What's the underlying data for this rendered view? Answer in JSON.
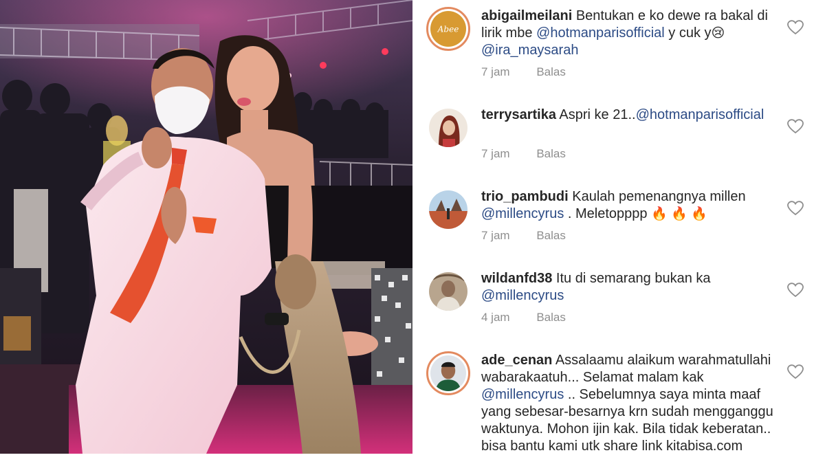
{
  "comments": [
    {
      "username": "abigailmeilani",
      "text_a": " Bentukan e ko dewe ra bakal di lirik mbe ",
      "mention_a": "@hotmanparisofficial",
      "text_b": " y cuk y",
      "emoji_a": "😢",
      "text_c": " ",
      "mention_b": "@ira_maysarah",
      "time": "7 jam",
      "reply": "Balas",
      "avatar_text": "Abee"
    },
    {
      "username": "terrysartika",
      "text_a": " Aspri ke 21..",
      "mention_a": "@hotmanparisofficial",
      "time": "7 jam",
      "reply": "Balas"
    },
    {
      "username": "trio_pambudi",
      "text_a": " Kaulah pemenangnya millen ",
      "mention_a": "@millencyrus",
      "text_b": " . Meletopppp",
      "emoji_a": "🔥 🔥 🔥",
      "time": "7 jam",
      "reply": "Balas"
    },
    {
      "username": "wildanfd38",
      "text_a": " Itu di semarang bukan ka ",
      "mention_a": "@millencyrus",
      "time": "4 jam",
      "reply": "Balas"
    },
    {
      "username": "ade_cenan",
      "text_a": " Assalaamu alaikum warahmatullahi wabarakaatuh... Selamat malam kak ",
      "mention_a": "@millencyrus",
      "text_b": " .. Sebelumnya saya minta maaf yang sebesar-besarnya krn sudah mengganggu waktunya. Mohon ijin kak. Bila tidak keberatan.. bisa bantu kami utk share link kitabisa.com"
    }
  ],
  "colors": {
    "mention": "#2c4b85",
    "meta": "#8e8e8e",
    "text": "#262626",
    "story_ring": "#e38a5f"
  },
  "icons": {
    "like": "heart-outline-icon"
  }
}
